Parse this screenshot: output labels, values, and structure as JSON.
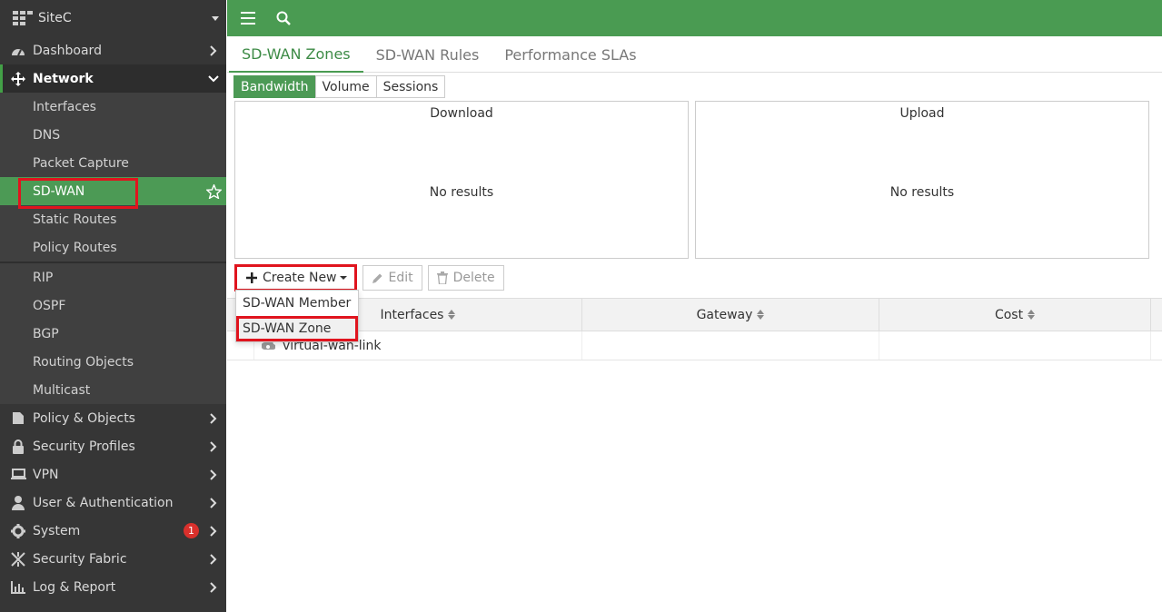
{
  "sidebar": {
    "device_name": "SiteC",
    "items": [
      {
        "label": "Dashboard"
      },
      {
        "label": "Network"
      },
      {
        "label": "Policy & Objects"
      },
      {
        "label": "Security Profiles"
      },
      {
        "label": "VPN"
      },
      {
        "label": "User & Authentication"
      },
      {
        "label": "System",
        "badge": "1"
      },
      {
        "label": "Security Fabric"
      },
      {
        "label": "Log & Report"
      }
    ],
    "network_sub": [
      {
        "label": "Interfaces"
      },
      {
        "label": "DNS"
      },
      {
        "label": "Packet Capture"
      },
      {
        "label": "SD-WAN"
      },
      {
        "label": "Static Routes"
      },
      {
        "label": "Policy Routes"
      },
      {
        "label": "RIP"
      },
      {
        "label": "OSPF"
      },
      {
        "label": "BGP"
      },
      {
        "label": "Routing Objects"
      },
      {
        "label": "Multicast"
      }
    ]
  },
  "tabs": [
    {
      "label": "SD-WAN Zones"
    },
    {
      "label": "SD-WAN Rules"
    },
    {
      "label": "Performance SLAs"
    }
  ],
  "metric_buttons": [
    {
      "label": "Bandwidth"
    },
    {
      "label": "Volume"
    },
    {
      "label": "Sessions"
    }
  ],
  "panels": {
    "download": {
      "title": "Download",
      "empty": "No results"
    },
    "upload": {
      "title": "Upload",
      "empty": "No results"
    }
  },
  "toolbar": {
    "create_label": "Create New",
    "edit_label": "Edit",
    "delete_label": "Delete"
  },
  "dropdown": {
    "items": [
      {
        "label": "SD-WAN Member"
      },
      {
        "label": "SD-WAN Zone"
      }
    ]
  },
  "table": {
    "columns": [
      "Interfaces",
      "Gateway",
      "Cost"
    ],
    "rows": [
      {
        "interface": "virtual-wan-link"
      }
    ]
  },
  "colors": {
    "accent": "#4a9b52",
    "sidebar": "#363636",
    "highlight_box": "#e0141e"
  }
}
